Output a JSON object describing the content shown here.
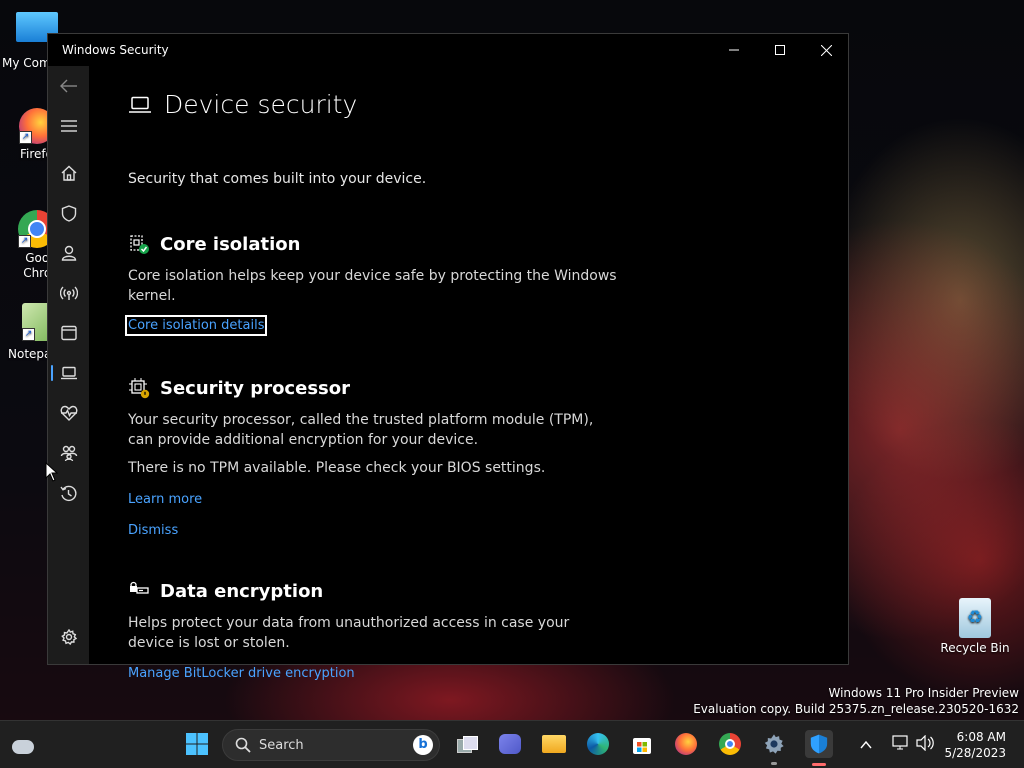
{
  "desktop": {
    "icons": [
      {
        "label": "My Com"
      },
      {
        "label": "Firefo"
      },
      {
        "label": "Goog Chron"
      },
      {
        "label": "Notepa"
      },
      {
        "label": "Recycle Bin"
      }
    ],
    "watermark_line1": "Windows 11 Pro Insider Preview",
    "watermark_line2": "Evaluation copy. Build 25375.zn_release.230520-1632"
  },
  "window": {
    "title": "Windows Security",
    "controls": {
      "minimize": "minimize-icon",
      "maximize": "maximize-icon",
      "close": "close-icon"
    }
  },
  "nav": {
    "items": [
      {
        "icon": "back-arrow-icon"
      },
      {
        "icon": "hamburger-menu-icon"
      },
      {
        "icon": "home-icon"
      },
      {
        "icon": "shield-icon"
      },
      {
        "icon": "person-icon"
      },
      {
        "icon": "wifi-antenna-icon"
      },
      {
        "icon": "browser-window-icon"
      },
      {
        "icon": "laptop-icon",
        "active": true
      },
      {
        "icon": "heart-pulse-icon"
      },
      {
        "icon": "family-icon"
      },
      {
        "icon": "history-icon"
      },
      {
        "icon": "gear-icon"
      }
    ]
  },
  "page": {
    "title": "Device security",
    "subtitle": "Security that comes built into your device.",
    "core_isolation": {
      "heading": "Core isolation",
      "text": "Core isolation helps keep your device safe by protecting the Windows kernel.",
      "link": "Core isolation details"
    },
    "security_processor": {
      "heading": "Security processor",
      "text": "Your security processor, called the trusted platform module (TPM), can provide additional encryption for your device.",
      "warning": "There is no TPM available. Please check your BIOS settings.",
      "learn_more": "Learn more",
      "dismiss": "Dismiss"
    },
    "data_encryption": {
      "heading": "Data encryption",
      "text": "Helps protect your data from unauthorized access in case your device is lost or stolen.",
      "link": "Manage BitLocker drive encryption"
    }
  },
  "taskbar": {
    "search_placeholder": "Search",
    "time": "6:08 AM",
    "date": "5/28/2023",
    "colors": {
      "accent": "#4aa3ff",
      "active_indicator": "#ff6b6b"
    }
  }
}
